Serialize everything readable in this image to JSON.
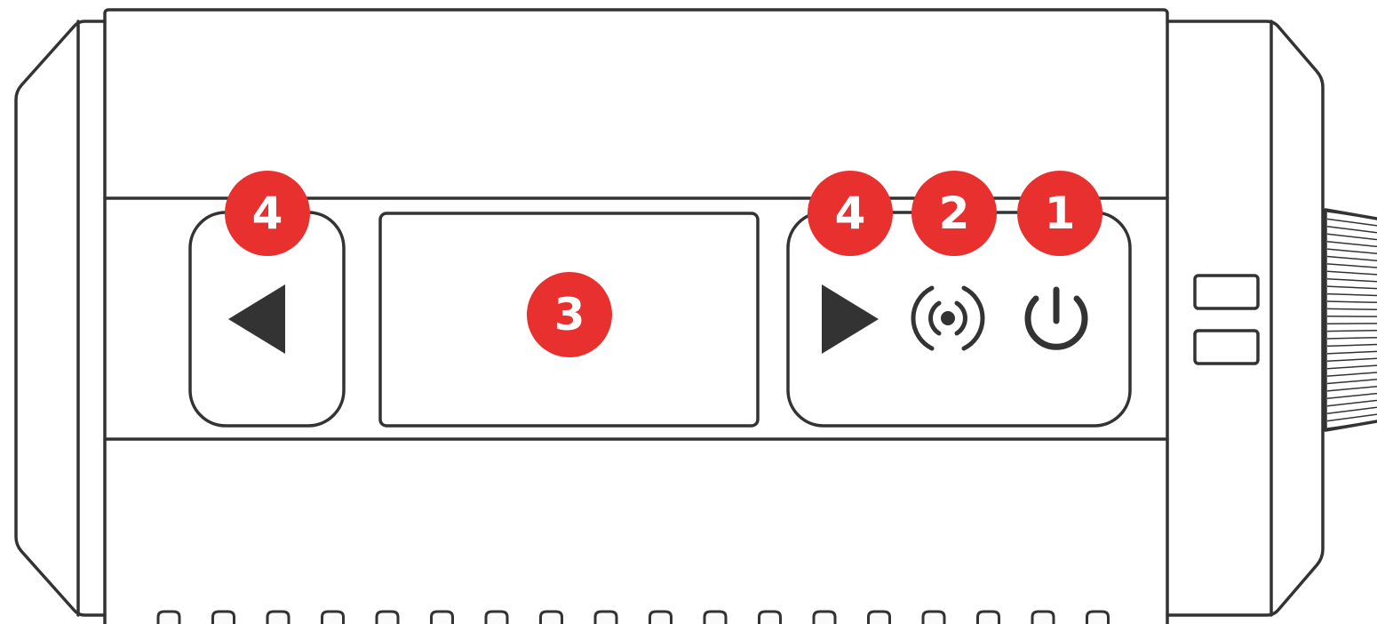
{
  "colors": {
    "outline": "#333333",
    "body_fill": "#fbfbfb",
    "callout": "#e8302e",
    "callout_text": "#ffffff"
  },
  "icons": {
    "left_button": "triangle-left-icon",
    "right_button": "triangle-right-icon",
    "wireless": "wireless-broadcast-icon",
    "power": "power-icon"
  },
  "callouts": {
    "prev_button": "4",
    "next_button": "4",
    "wireless_button": "2",
    "power_button": "1",
    "display": "3"
  }
}
